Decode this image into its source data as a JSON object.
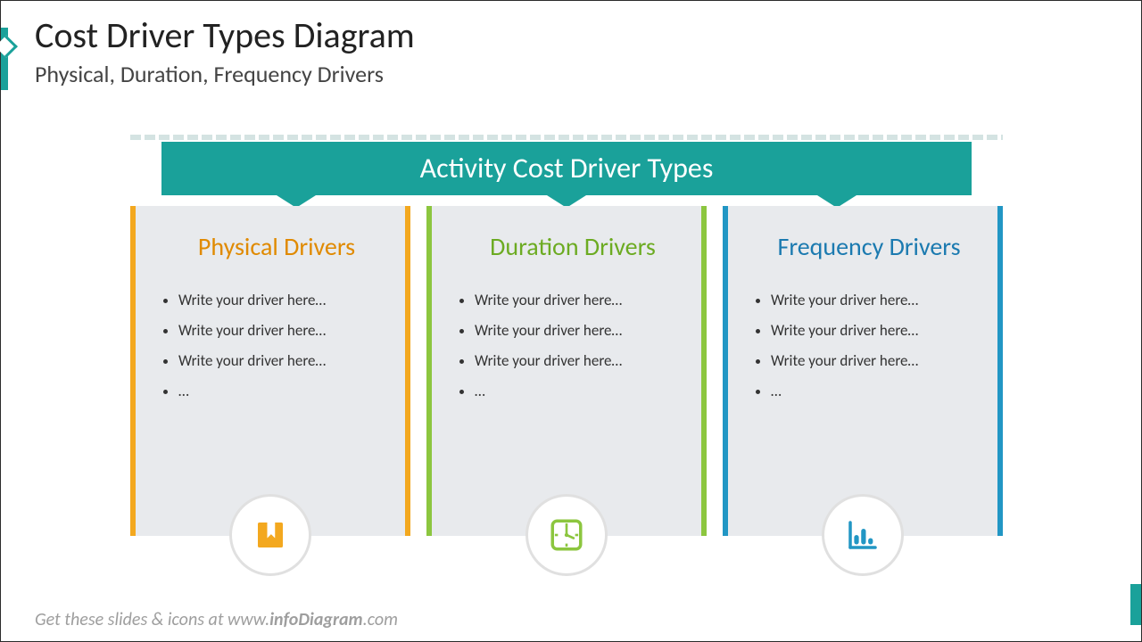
{
  "header": {
    "title": "Cost Driver Types Diagram",
    "subtitle": "Physical, Duration, Frequency Drivers"
  },
  "banner": {
    "label": "Activity Cost Driver Types"
  },
  "colors": {
    "teal": "#1aa19a",
    "orange": "#f3a81f",
    "green": "#8cc63f",
    "blue": "#2196c4"
  },
  "columns": [
    {
      "title": "Physical Drivers",
      "icon": "bookmark-icon",
      "bullets": [
        "Write your driver here…",
        "Write your driver here…",
        "Write your driver here…",
        "…"
      ]
    },
    {
      "title": "Duration Drivers",
      "icon": "clock-icon",
      "bullets": [
        "Write your driver here…",
        "Write your driver here…",
        "Write your driver here…",
        "…"
      ]
    },
    {
      "title": "Frequency Drivers",
      "icon": "bar-chart-icon",
      "bullets": [
        "Write your driver here…",
        "Write your driver here…",
        "Write your driver here…",
        "…"
      ]
    }
  ],
  "footer": {
    "prefix": "Get these slides & icons at www.",
    "brand": "infoDiagram",
    "suffix": ".com"
  }
}
